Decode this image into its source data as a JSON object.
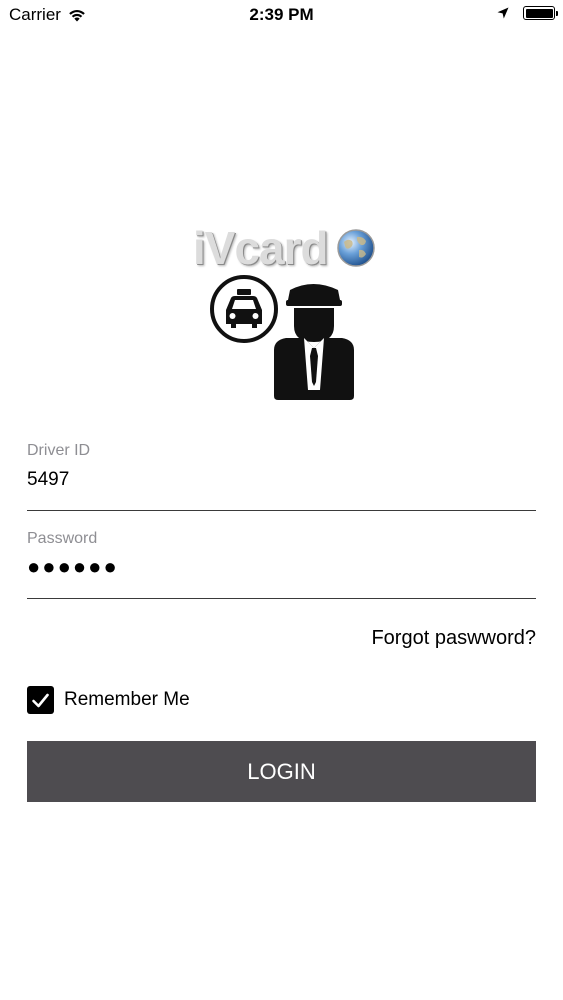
{
  "status_bar": {
    "carrier": "Carrier",
    "time": "2:39 PM",
    "icons": [
      "wifi-icon",
      "location-arrow-icon",
      "battery-icon"
    ]
  },
  "logo": {
    "text": "iVcard",
    "icons": [
      "globe-icon",
      "taxi-icon",
      "driver-icon"
    ]
  },
  "form": {
    "driver_id": {
      "label": "Driver ID",
      "value": "5497"
    },
    "password": {
      "label": "Password",
      "value": "●●●●●●"
    },
    "forgot_label": "Forgot paswword?",
    "remember_label": "Remember Me",
    "remember_checked": true,
    "login_label": "LOGIN"
  },
  "colors": {
    "button_bg": "#4e4c50",
    "label": "#8e8e93",
    "underline": "#3a3a3a"
  }
}
